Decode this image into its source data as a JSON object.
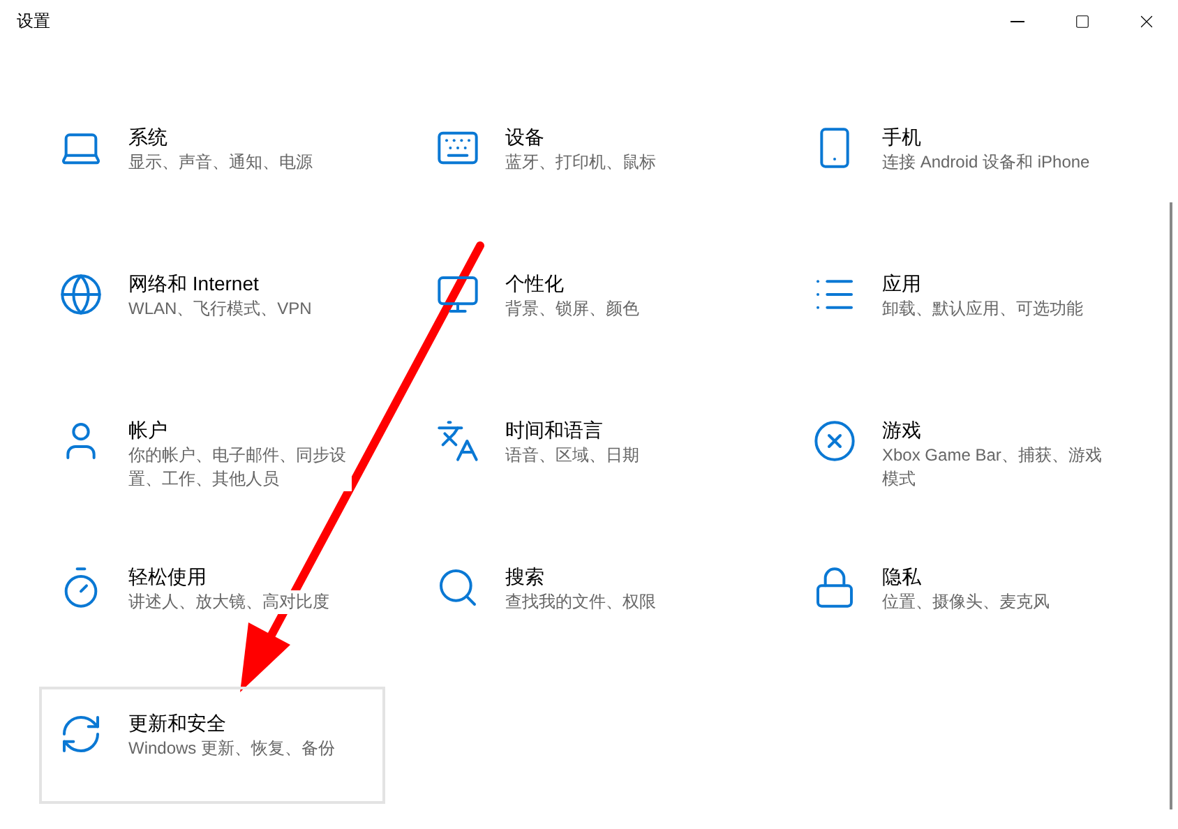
{
  "window": {
    "title": "设置"
  },
  "tiles": [
    {
      "title": "系统",
      "subtitle": "显示、声音、通知、电源",
      "selected": false
    },
    {
      "title": "设备",
      "subtitle": "蓝牙、打印机、鼠标",
      "selected": false
    },
    {
      "title": "手机",
      "subtitle": "连接 Android 设备和 iPhone",
      "selected": false
    },
    {
      "title": "网络和 Internet",
      "subtitle": "WLAN、飞行模式、VPN",
      "selected": false
    },
    {
      "title": "个性化",
      "subtitle": "背景、锁屏、颜色",
      "selected": false
    },
    {
      "title": "应用",
      "subtitle": "卸载、默认应用、可选功能",
      "selected": false
    },
    {
      "title": "帐户",
      "subtitle": "你的帐户、电子邮件、同步设置、工作、其他人员",
      "selected": false
    },
    {
      "title": "时间和语言",
      "subtitle": "语音、区域、日期",
      "selected": false
    },
    {
      "title": "游戏",
      "subtitle": "Xbox Game Bar、捕获、游戏模式",
      "selected": false
    },
    {
      "title": "轻松使用",
      "subtitle": "讲述人、放大镜、高对比度",
      "selected": false
    },
    {
      "title": "搜索",
      "subtitle": "查找我的文件、权限",
      "selected": false
    },
    {
      "title": "隐私",
      "subtitle": "位置、摄像头、麦克风",
      "selected": false
    },
    {
      "title": "更新和安全",
      "subtitle": "Windows 更新、恢复、备份",
      "selected": true
    }
  ]
}
